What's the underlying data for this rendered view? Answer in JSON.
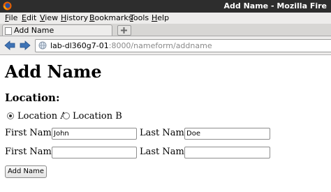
{
  "window": {
    "title": "Add Name - Mozilla Fire"
  },
  "menu": [
    {
      "accel": "F",
      "rest": "ile"
    },
    {
      "accel": "E",
      "rest": "dit"
    },
    {
      "accel": "V",
      "rest": "iew"
    },
    {
      "accel": "H",
      "rest": "istory"
    },
    {
      "accel": "B",
      "rest": "ookmarks"
    },
    {
      "accel": "T",
      "rest": "ools"
    },
    {
      "accel": "H",
      "rest": "elp"
    }
  ],
  "tabs": [
    {
      "label": "Add Name"
    }
  ],
  "url": {
    "host": "lab-dl360g7-01",
    "rest": ":8000/nameform/addname"
  },
  "page": {
    "heading": "Add Name",
    "location_label": "Location:",
    "locations": [
      {
        "label": "Location A",
        "checked": true
      },
      {
        "label": "Location B",
        "checked": false
      }
    ],
    "rows": [
      {
        "first_label": "First Name:",
        "first_value": "John",
        "last_label": "Last Name:",
        "last_value": "Doe"
      },
      {
        "first_label": "First Name:",
        "first_value": "",
        "last_label": "Last Name:",
        "last_value": ""
      }
    ],
    "submit_label": "Add Name"
  }
}
